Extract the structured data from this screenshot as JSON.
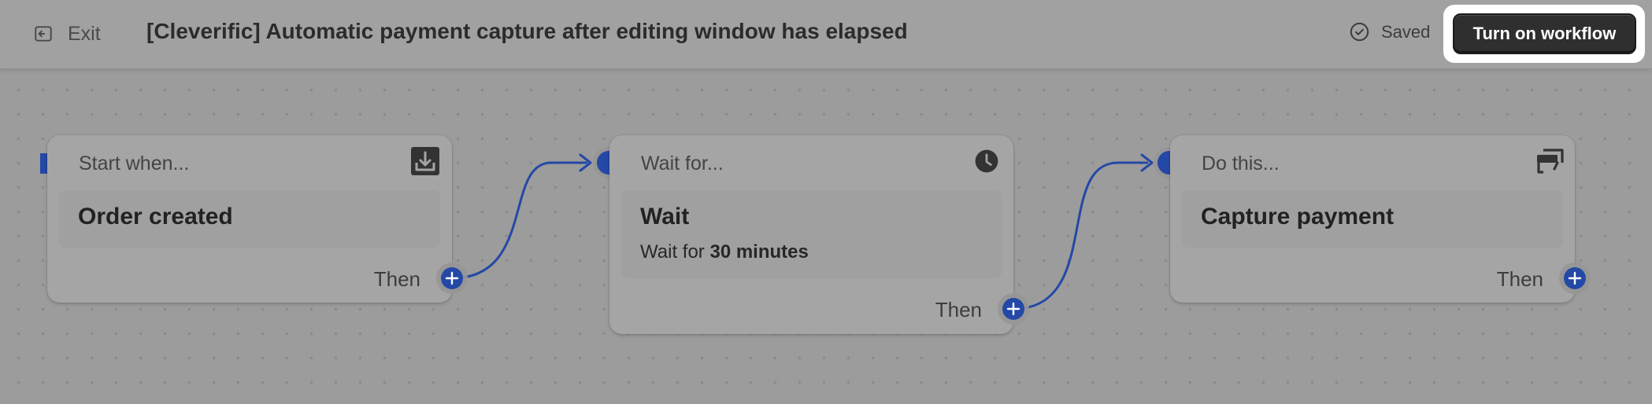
{
  "topbar": {
    "exit_label": "Exit",
    "workflow_title": "[Cleverific] Automatic payment capture after editing window has elapsed",
    "saved_label": "Saved",
    "cta_label": "Turn on workflow"
  },
  "nodes": [
    {
      "header": "Start when...",
      "icon": "download-tray-icon",
      "body_title": "Order created",
      "then_label": "Then"
    },
    {
      "header": "Wait for...",
      "icon": "clock-icon",
      "body_title": "Wait",
      "body_sub_prefix": "Wait for",
      "body_sub_value": "30 minutes",
      "then_label": "Then"
    },
    {
      "header": "Do this...",
      "icon": "card-stack-icon",
      "body_title": "Capture payment",
      "then_label": "Then"
    }
  ],
  "colors": {
    "accent": "#2448a6",
    "cta_bg": "#2f2f2f",
    "overlay_bg": "#9d9d9d"
  }
}
